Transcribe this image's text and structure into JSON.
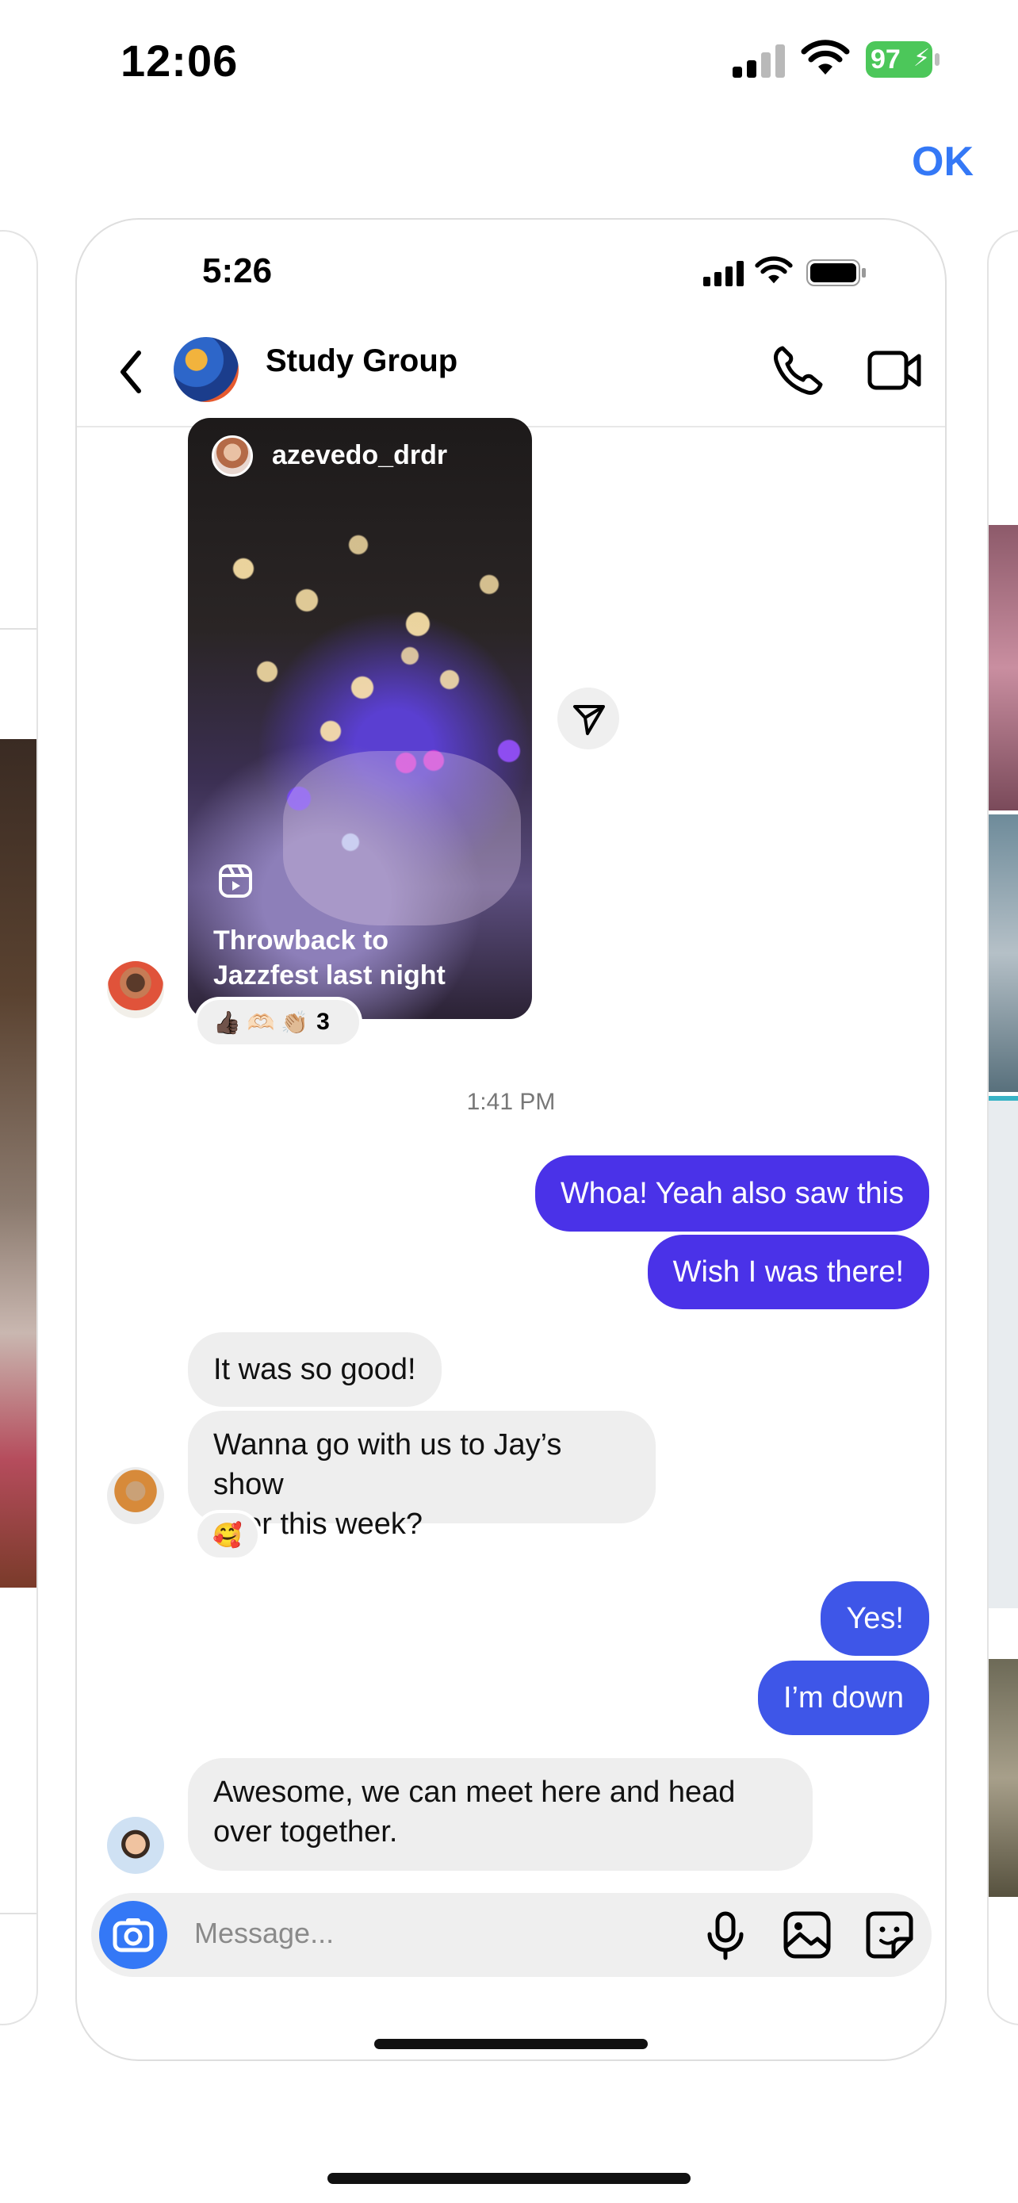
{
  "status_bar": {
    "time": "12:06",
    "battery": "97"
  },
  "ok_label": "OK",
  "phone": {
    "status_time": "5:26",
    "header": {
      "title": "Study Group"
    },
    "reel": {
      "username": "azevedo_drdr",
      "caption_line1": "Throwback to",
      "caption_line2": "Jazzfest last night",
      "reaction_count": "3",
      "reactions": "👍🏿 🫶🏻 👏🏼"
    },
    "timestamp": "1:41 PM",
    "messages": [
      {
        "text": "Whoa! Yeah also saw this"
      },
      {
        "text": "Wish I was there!"
      },
      {
        "text": "It was so good!"
      },
      {
        "line1": "Wanna go with us to Jay’s show",
        "line2": "later this week?"
      },
      {
        "text": "Yes!"
      },
      {
        "text": "I’m down"
      },
      {
        "line1": "Awesome, we can meet here and head",
        "line2": "over together."
      }
    ],
    "sticker_reaction": "🥰",
    "composer": {
      "placeholder": "Message..."
    }
  }
}
